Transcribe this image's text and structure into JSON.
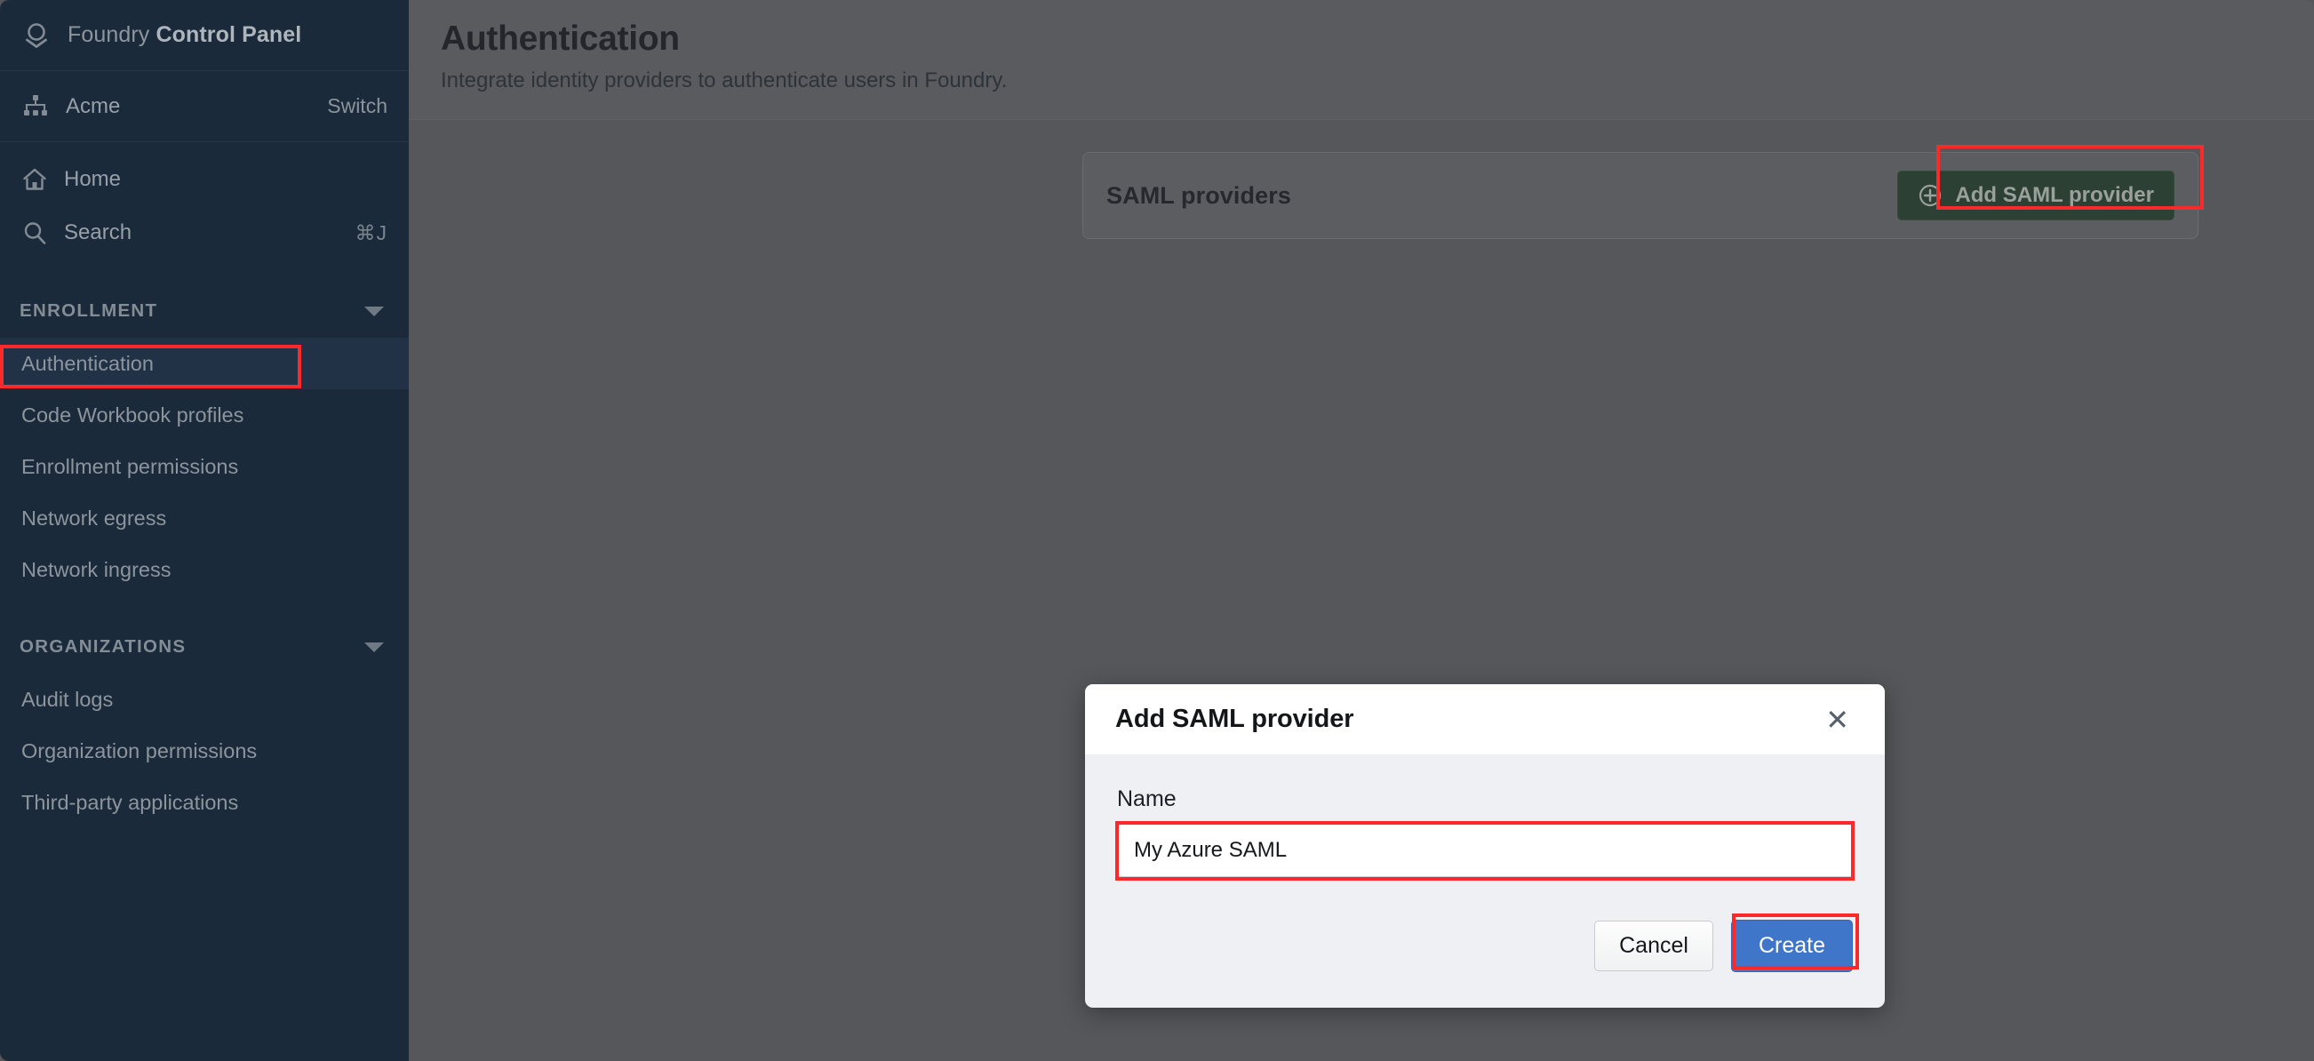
{
  "brand": {
    "logo_icon": "foundry-logo-icon",
    "name_light": "Foundry ",
    "name_bold": "Control Panel"
  },
  "org": {
    "icon": "org-hierarchy-icon",
    "name": "Acme",
    "switch_label": "Switch"
  },
  "sidebar": {
    "links": [
      {
        "label": "Home",
        "icon": "home-icon",
        "shortcut": ""
      },
      {
        "label": "Search",
        "icon": "search-icon",
        "shortcut": "⌘J"
      }
    ],
    "sections": [
      {
        "title": "ENROLLMENT",
        "caret": "chevron-down-icon",
        "items": [
          {
            "label": "Authentication",
            "active": true
          },
          {
            "label": "Code Workbook profiles",
            "active": false
          },
          {
            "label": "Enrollment permissions",
            "active": false
          },
          {
            "label": "Network egress",
            "active": false
          },
          {
            "label": "Network ingress",
            "active": false
          }
        ]
      },
      {
        "title": "ORGANIZATIONS",
        "caret": "chevron-down-icon",
        "items": [
          {
            "label": "Audit logs",
            "active": false
          },
          {
            "label": "Organization permissions",
            "active": false
          },
          {
            "label": "Third-party applications",
            "active": false
          }
        ]
      }
    ]
  },
  "page": {
    "title": "Authentication",
    "subtitle": "Integrate identity providers to authenticate users in Foundry."
  },
  "saml_card": {
    "title": "SAML providers",
    "add_button_label": "Add SAML provider",
    "add_button_icon": "plus-circle-icon"
  },
  "modal": {
    "title": "Add SAML provider",
    "close_icon": "close-icon",
    "field_label": "Name",
    "field_value": "My Azure SAML",
    "field_placeholder": "",
    "cancel_label": "Cancel",
    "create_label": "Create"
  },
  "colors": {
    "sidebar_bg": "#1b2a3a",
    "sidebar_active": "#223246",
    "main_bg": "#55575b",
    "header_bg": "#595b5f",
    "card_bg": "#5b5d61",
    "add_button_bg": "#2d4034",
    "primary_button_bg": "#3f76ca",
    "highlight_outline": "#fb2a2a",
    "modal_bg": "#eef0f3",
    "modal_header_bg": "#ffffff"
  }
}
